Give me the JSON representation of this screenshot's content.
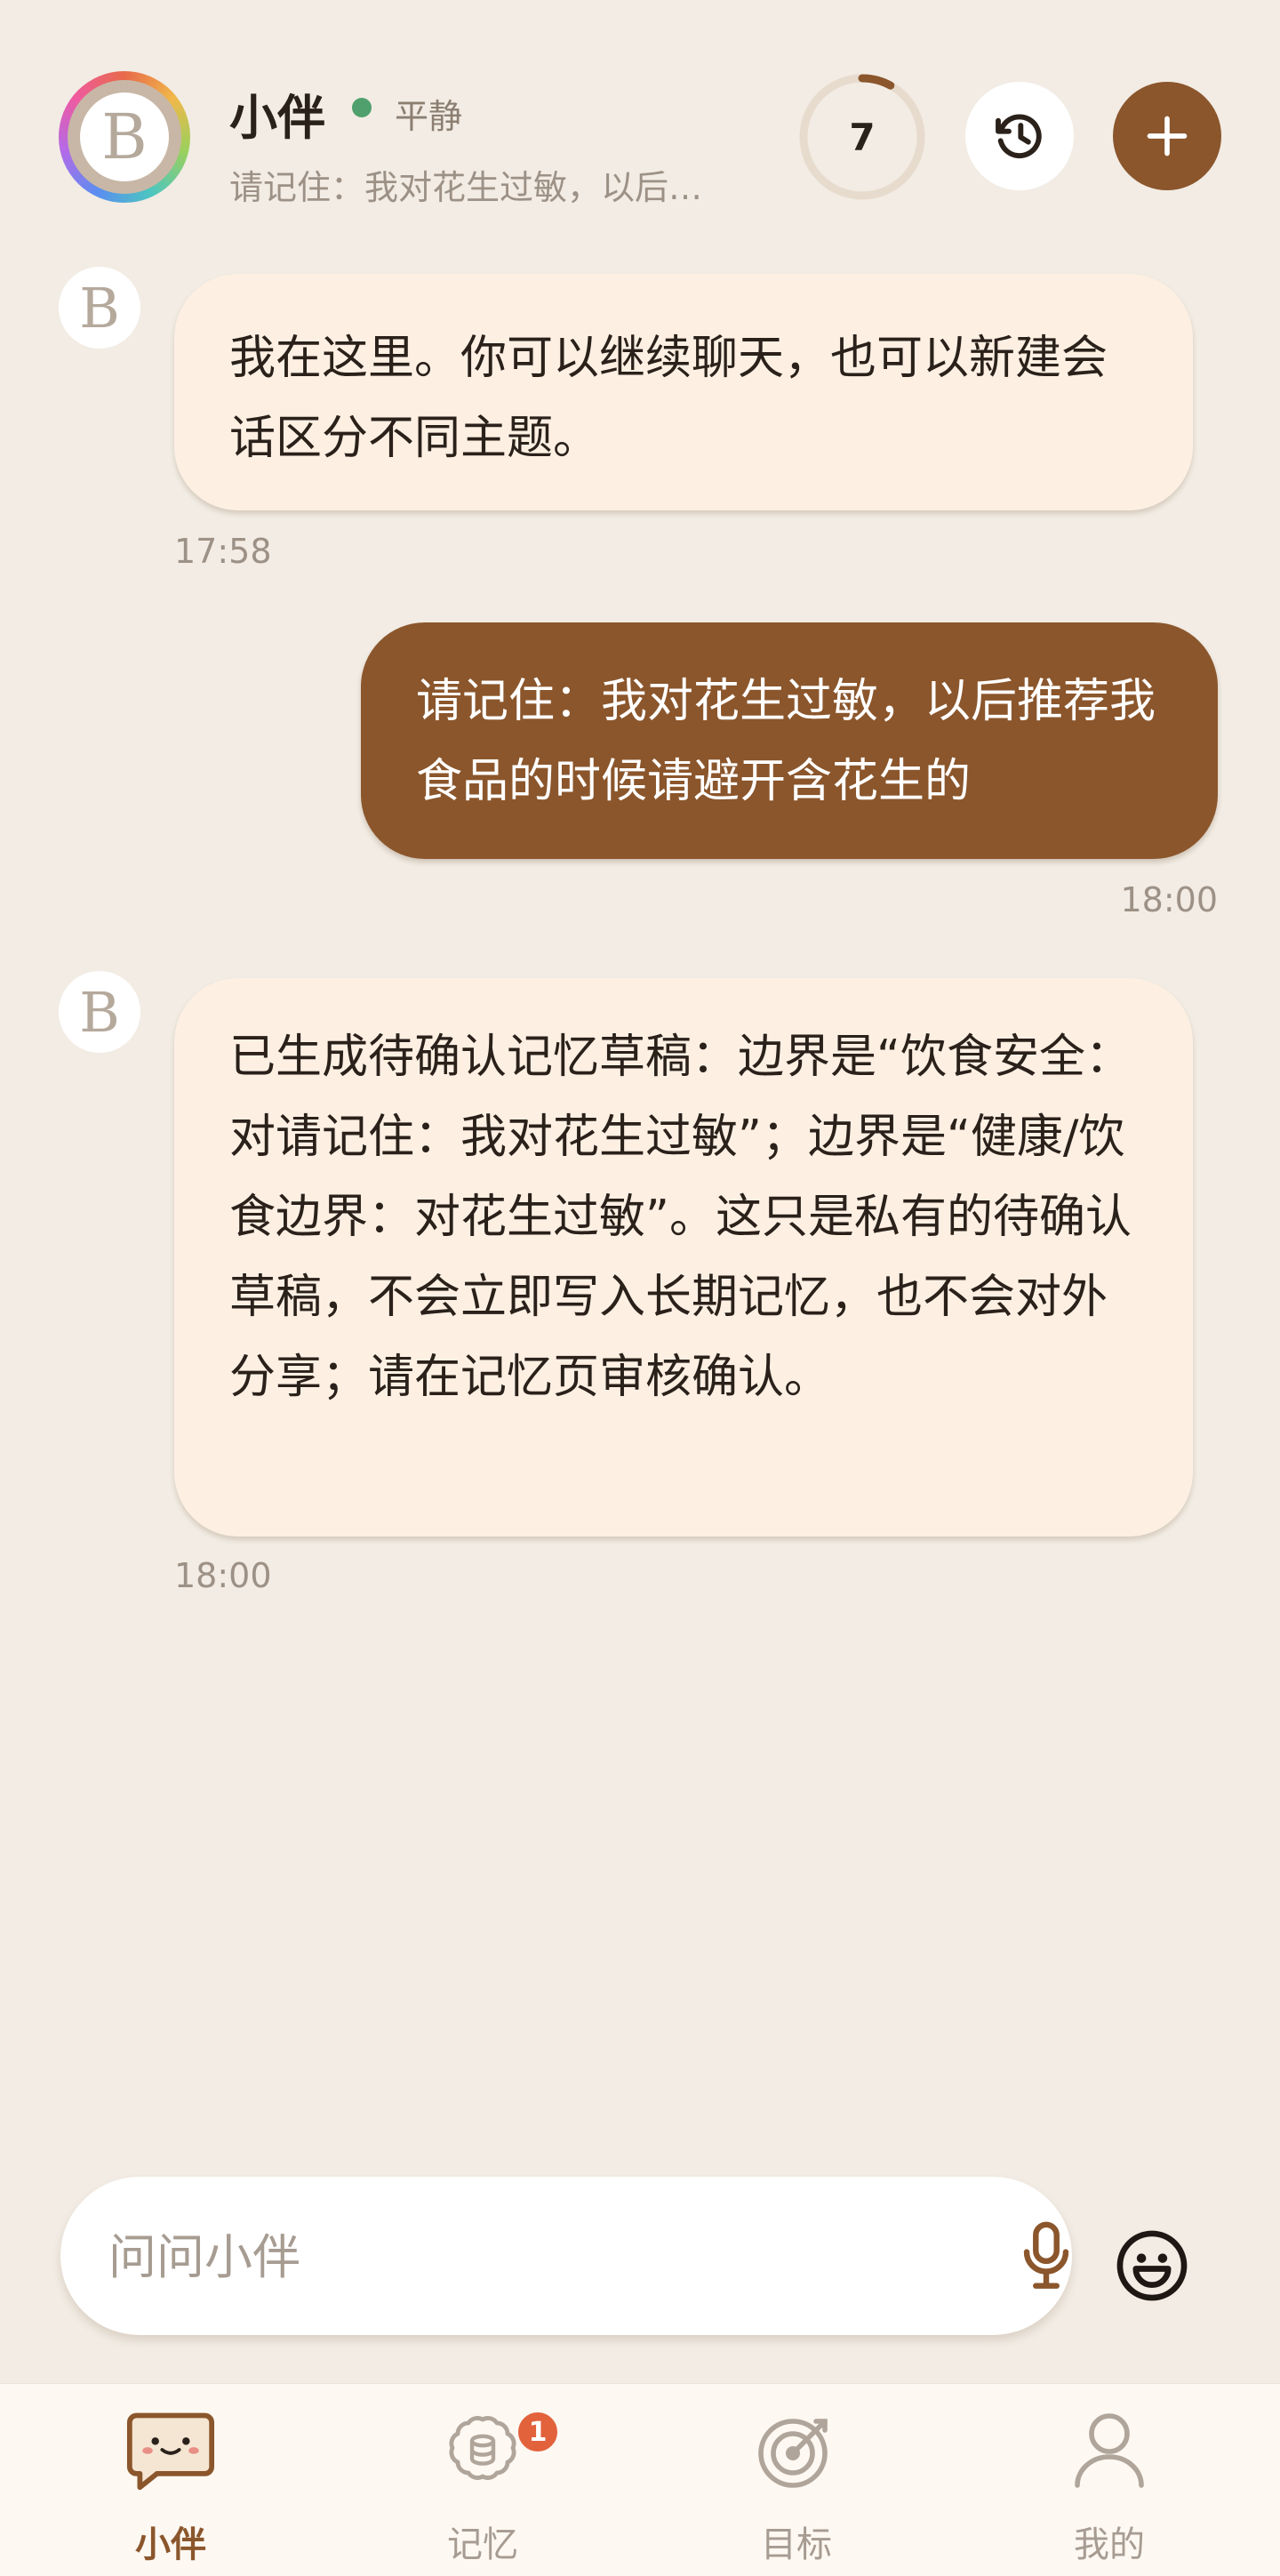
{
  "header": {
    "avatar_letter": "B",
    "name": "小伴",
    "status": "平静",
    "status_color": "#4fa06c",
    "subtitle": "请记住：我对花生过敏，以后推荐我食品的时候请避开含花生的",
    "progress_value": 7,
    "progress_fraction": 0.08,
    "history_icon": "history-icon",
    "new_icon": "plus-icon"
  },
  "messages": [
    {
      "role": "assistant",
      "avatar_letter": "B",
      "text": "我在这里。你可以继续聊天，也可以新建会话区分不同主题。",
      "time": "17:58"
    },
    {
      "role": "user",
      "text": "请记住：我对花生过敏，以后推荐我食品的时候请避开含花生的",
      "time": "18:00"
    },
    {
      "role": "assistant",
      "avatar_letter": "B",
      "text": "已生成待确认记忆草稿：边界是“饮食安全：对请记住：我对花生过敏”；边界是“健康/饮食边界：对花生过敏”。这只是私有的待确认草稿，不会立即写入长期记忆，也不会对外分享；请在记忆页审核确认。",
      "time": "18:00"
    }
  ],
  "composer": {
    "placeholder": "问问小伴",
    "mic_icon": "microphone-icon",
    "emoji_icon": "emoji-icon"
  },
  "tabs": [
    {
      "label": "小伴",
      "icon": "chat-icon",
      "active": true
    },
    {
      "label": "记忆",
      "icon": "brain-icon",
      "badge": "1"
    },
    {
      "label": "目标",
      "icon": "target-icon"
    },
    {
      "label": "我的",
      "icon": "person-icon"
    }
  ],
  "colors": {
    "background": "#f2ece4",
    "accent": "#8b562c",
    "bot_bubble": "#fdf0e3",
    "badge": "#e2623c"
  }
}
